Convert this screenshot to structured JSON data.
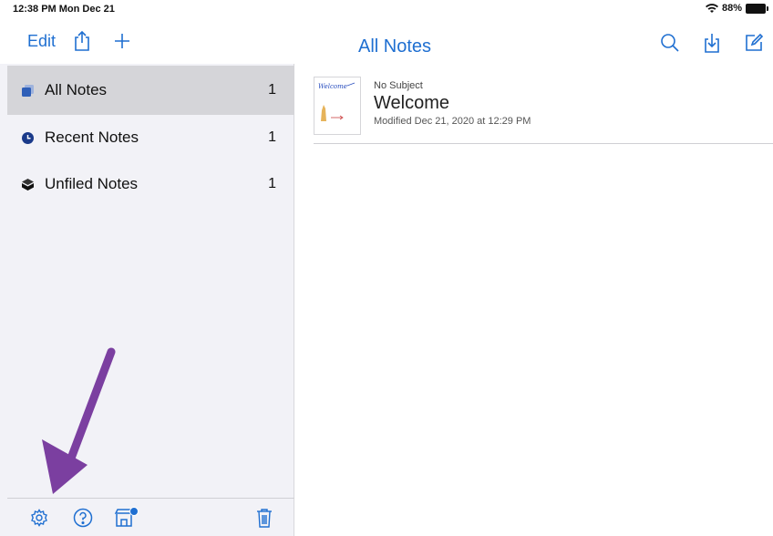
{
  "status": {
    "time": "12:38 PM  Mon Dec 21",
    "battery": "88%"
  },
  "nav": {
    "edit_label": "Edit",
    "title": "All Notes"
  },
  "sidebar": {
    "items": [
      {
        "label": "All Notes",
        "count": "1",
        "icon": "notes-stack-icon"
      },
      {
        "label": "Recent Notes",
        "count": "1",
        "icon": "clock-icon"
      },
      {
        "label": "Unfiled Notes",
        "count": "1",
        "icon": "box-icon"
      }
    ],
    "footer_icons": [
      "gear-icon",
      "help-icon",
      "store-icon",
      "trash-icon"
    ]
  },
  "notes": [
    {
      "thumb_text": "Welcome",
      "subject": "No Subject",
      "title": "Welcome",
      "modified": "Modified Dec 21, 2020 at 12:29 PM"
    }
  ],
  "colors": {
    "accent": "#1f6fd1",
    "sidebar_bg": "#f2f2f7",
    "arrow": "#7b3fa0"
  }
}
